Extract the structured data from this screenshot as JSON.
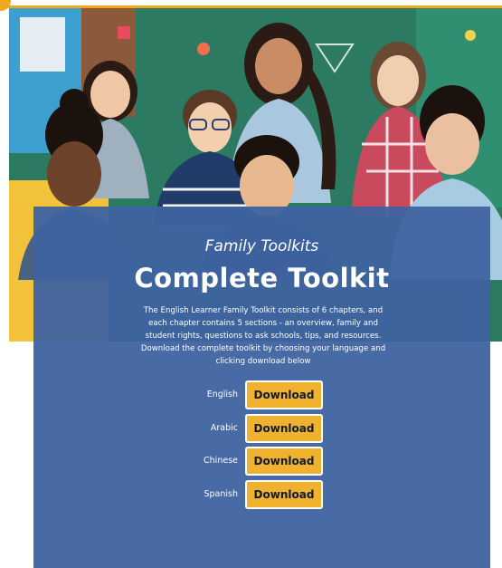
{
  "hero": {
    "colors": {
      "chalkboard": "#2f7d63",
      "accent": "#f0a81c"
    }
  },
  "panel": {
    "eyebrow": "Family Toolkits",
    "title": "Complete Toolkit",
    "description": "The English Learner Family Toolkit consists of 6 chapters, and each chapter contains 5 sections - an overview, family and student rights, questions to ask schools, tips, and resources. Download the complete toolkit by choosing your language and clicking download below",
    "background_color": "#3e63a0"
  },
  "downloads": [
    {
      "language": "English",
      "button_label": "Download"
    },
    {
      "language": "Arabic",
      "button_label": "Download"
    },
    {
      "language": "Chinese",
      "button_label": "Download"
    },
    {
      "language": "Spanish",
      "button_label": "Download"
    }
  ],
  "button_color": "#f0b12f"
}
